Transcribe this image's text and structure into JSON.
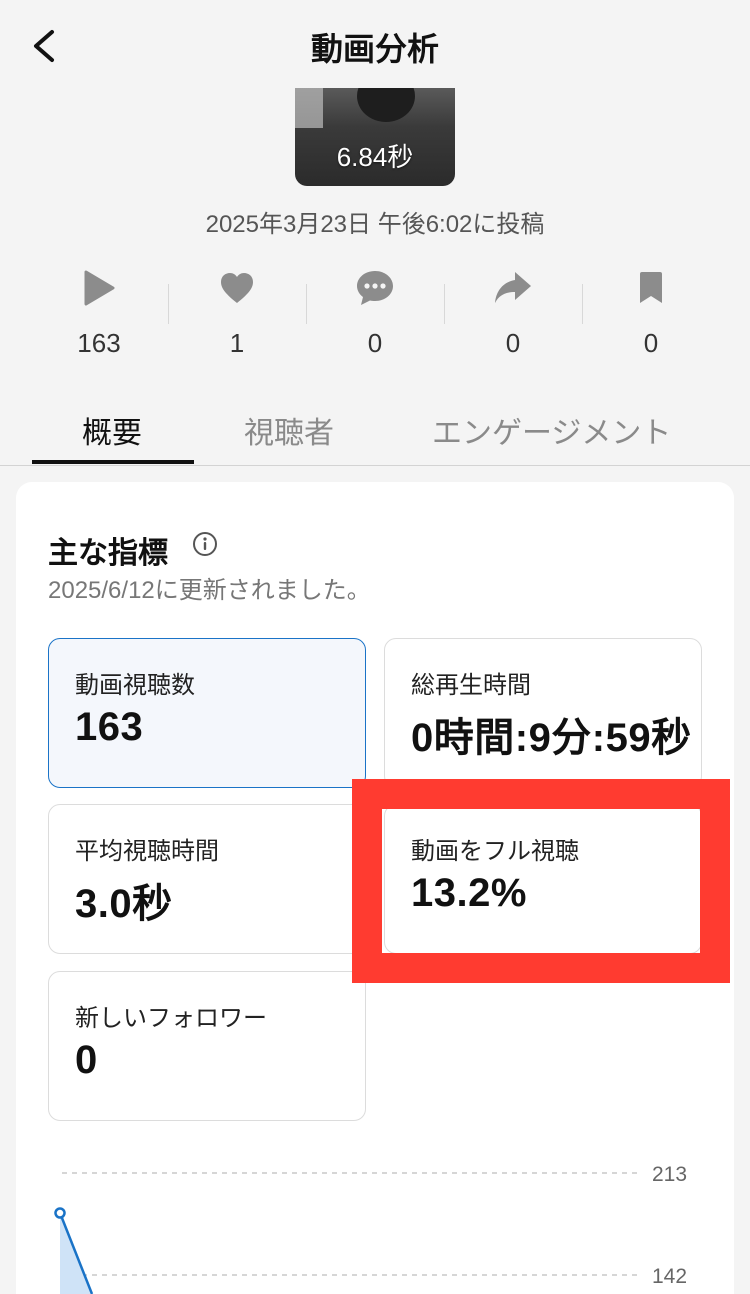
{
  "header": {
    "title": "動画分析",
    "back_icon": "chevron-left-icon"
  },
  "video": {
    "duration": "6.84秒",
    "posted": "2025年3月23日 午後6:02に投稿"
  },
  "stats": [
    {
      "icon": "play-icon",
      "value": "163"
    },
    {
      "icon": "heart-icon",
      "value": "1"
    },
    {
      "icon": "comment-icon",
      "value": "0"
    },
    {
      "icon": "share-icon",
      "value": "0"
    },
    {
      "icon": "bookmark-icon",
      "value": "0"
    }
  ],
  "tabs": [
    {
      "label": "概要",
      "active": true
    },
    {
      "label": "視聴者",
      "active": false
    },
    {
      "label": "エンゲージメント",
      "active": false
    }
  ],
  "key_metrics": {
    "title": "主な指標",
    "updated": "2025/6/12に更新されました。",
    "items": [
      {
        "label": "動画視聴数",
        "value": "163",
        "selected": true
      },
      {
        "label": "総再生時間",
        "value": "0時間:9分:59秒",
        "selected": false
      },
      {
        "label": "平均視聴時間",
        "value": "3.0秒",
        "selected": false
      },
      {
        "label": "動画をフル視聴",
        "value": "13.2%",
        "selected": false,
        "highlighted": true
      },
      {
        "label": "新しいフォロワー",
        "value": "0",
        "selected": false
      }
    ]
  },
  "chart_data": {
    "type": "area",
    "y_ticks": [
      "213",
      "142"
    ],
    "grid": "dashed",
    "color": "#1a73c7"
  },
  "colors": {
    "accent": "#1a73c7",
    "highlight": "#ff3b30",
    "background": "#f4f4f4"
  }
}
